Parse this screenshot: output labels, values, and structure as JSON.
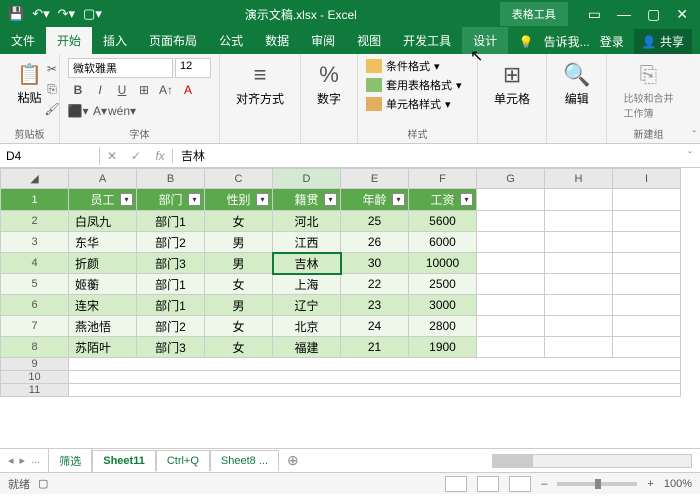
{
  "title": "演示文稿.xlsx - Excel",
  "tabtools": "表格工具",
  "tabs": {
    "file": "文件",
    "home": "开始",
    "insert": "插入",
    "layout": "页面布局",
    "formulas": "公式",
    "data": "数据",
    "review": "审阅",
    "view": "视图",
    "dev": "开发工具",
    "design": "设计"
  },
  "tellme": "告诉我...",
  "login": "登录",
  "share": "共享",
  "ribbon": {
    "clipboard": {
      "paste": "粘贴",
      "label": "剪贴板"
    },
    "font": {
      "name": "微软雅黑",
      "size": "12",
      "label": "字体"
    },
    "align": {
      "label": "对齐方式"
    },
    "number": {
      "label": "数字",
      "pct": "%"
    },
    "styles": {
      "cond": "条件格式",
      "table": "套用表格格式",
      "cell": "单元格样式",
      "label": "样式"
    },
    "cells": {
      "label": "单元格"
    },
    "edit": {
      "label": "编辑"
    },
    "newgroup": {
      "main": "比较和合并工作簿",
      "label": "新建组"
    }
  },
  "namebox": "D4",
  "fx": "fx",
  "formula": "吉林",
  "cols": [
    "A",
    "B",
    "C",
    "D",
    "E",
    "F",
    "G",
    "H",
    "I"
  ],
  "headers": [
    "员工",
    "部门",
    "性别",
    "籍贯",
    "年龄",
    "工资"
  ],
  "rows": [
    {
      "n": "白凤九",
      "d": "部门1",
      "s": "女",
      "p": "河北",
      "a": "25",
      "w": "5600"
    },
    {
      "n": "东华",
      "d": "部门2",
      "s": "男",
      "p": "江西",
      "a": "26",
      "w": "6000"
    },
    {
      "n": "折颜",
      "d": "部门3",
      "s": "男",
      "p": "吉林",
      "a": "30",
      "w": "10000"
    },
    {
      "n": "姬蘅",
      "d": "部门1",
      "s": "女",
      "p": "上海",
      "a": "22",
      "w": "2500"
    },
    {
      "n": "连宋",
      "d": "部门1",
      "s": "男",
      "p": "辽宁",
      "a": "23",
      "w": "3000"
    },
    {
      "n": "燕池悟",
      "d": "部门2",
      "s": "女",
      "p": "北京",
      "a": "24",
      "w": "2800"
    },
    {
      "n": "苏陌叶",
      "d": "部门3",
      "s": "女",
      "p": "福建",
      "a": "21",
      "w": "1900"
    }
  ],
  "sheets": {
    "filter": "筛选",
    "s11": "Sheet11",
    "ctrlq": "Ctrl+Q",
    "s8": "Sheet8",
    "more": "..."
  },
  "status": {
    "ready": "就绪",
    "rec": "",
    "zoom": "100%",
    "plus": "+",
    "minus": "–"
  }
}
